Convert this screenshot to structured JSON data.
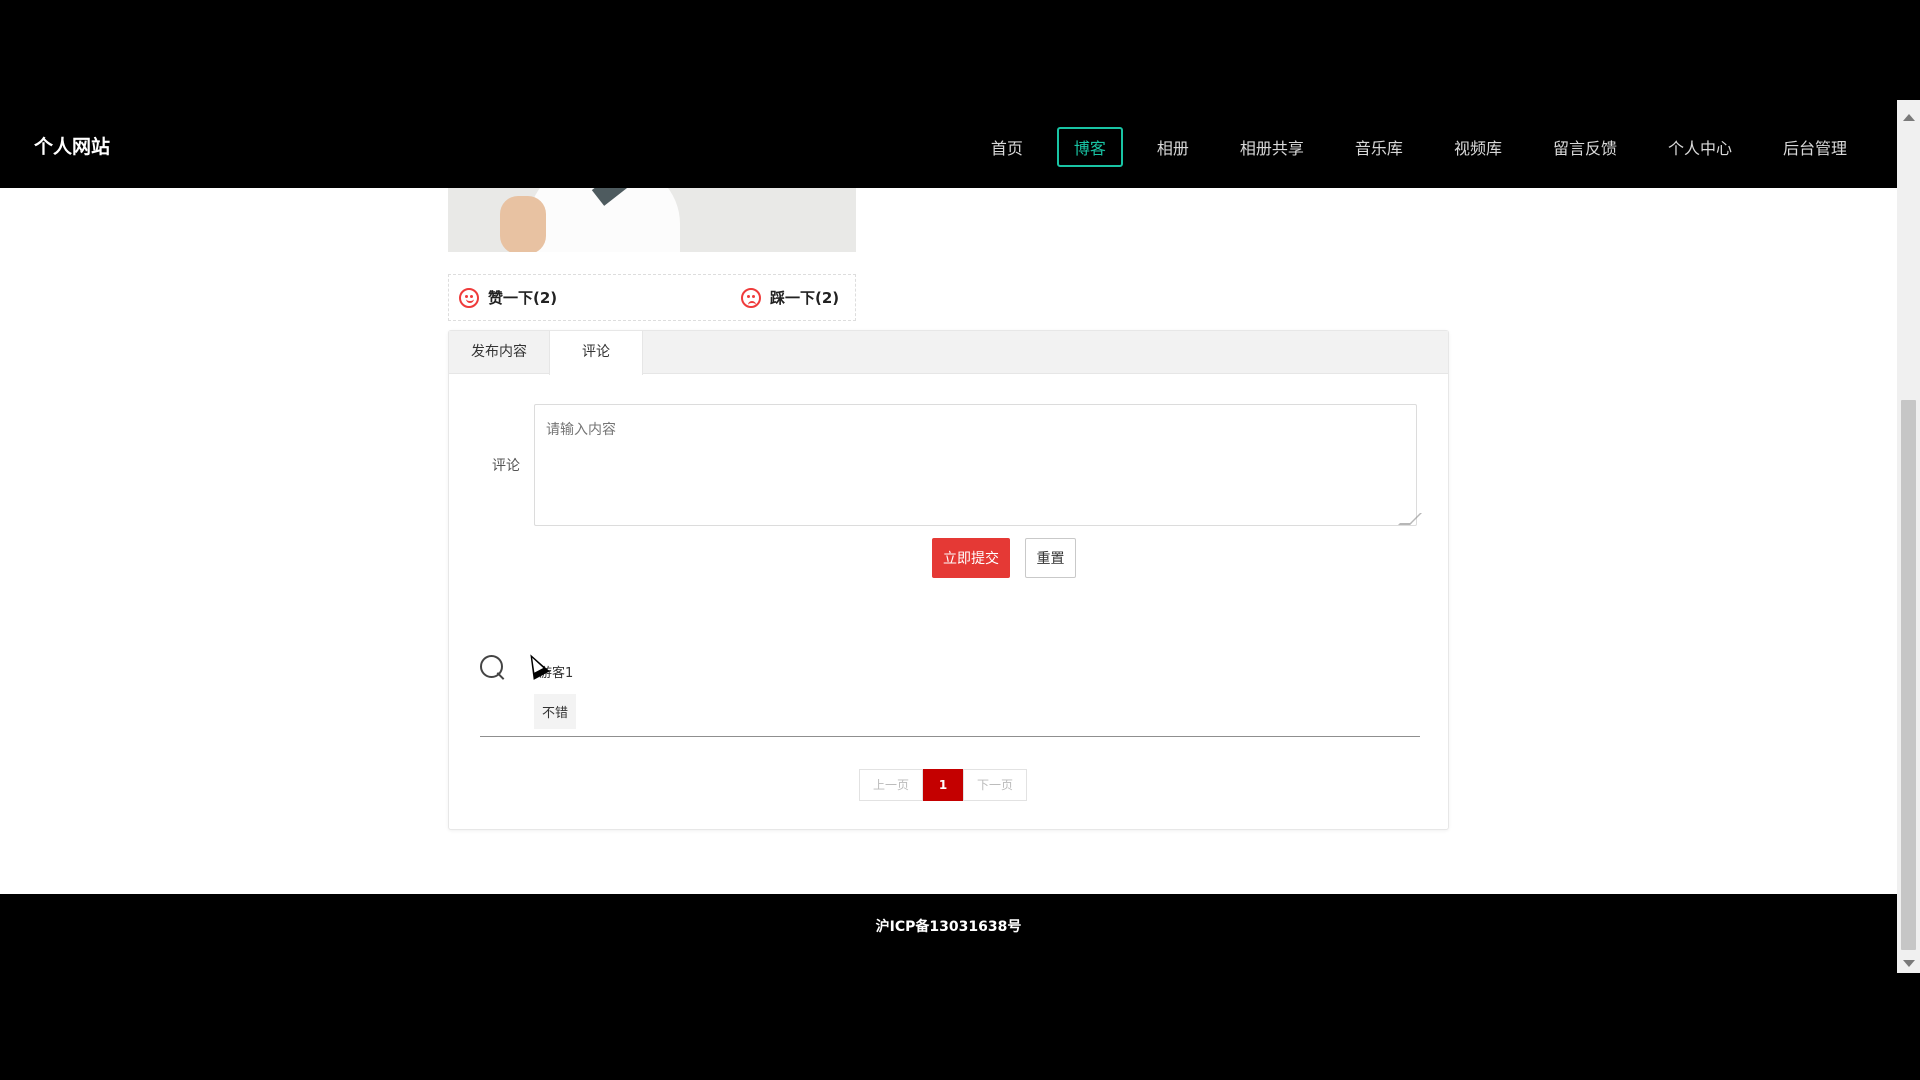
{
  "site": {
    "brand": "个人网站"
  },
  "nav": {
    "items": [
      {
        "label": "首页",
        "active": false
      },
      {
        "label": "博客",
        "active": true
      },
      {
        "label": "相册",
        "active": false
      },
      {
        "label": "相册共享",
        "active": false
      },
      {
        "label": "音乐库",
        "active": false
      },
      {
        "label": "视频库",
        "active": false
      },
      {
        "label": "留言反馈",
        "active": false
      },
      {
        "label": "个人中心",
        "active": false
      },
      {
        "label": "后台管理",
        "active": false
      }
    ]
  },
  "reactions": {
    "like": "赞一下(2)",
    "dislike": "踩一下(2)"
  },
  "tabs": [
    {
      "label": "发布内容",
      "active": false
    },
    {
      "label": "评论",
      "active": true
    }
  ],
  "comment_form": {
    "label": "评论",
    "placeholder": "请输入内容",
    "submit": "立即提交",
    "reset": "重置"
  },
  "comments": [
    {
      "user": "游客1",
      "text": "不错"
    }
  ],
  "pagination": {
    "prev": "上一页",
    "current": "1",
    "next": "下一页"
  },
  "footer": {
    "text": "沪ICP备13031638号"
  },
  "colors": {
    "nav_active": "#19c4a4",
    "primary": "#e53935",
    "page_current": "#c40000",
    "reaction_icon": "#ef3b3b"
  }
}
